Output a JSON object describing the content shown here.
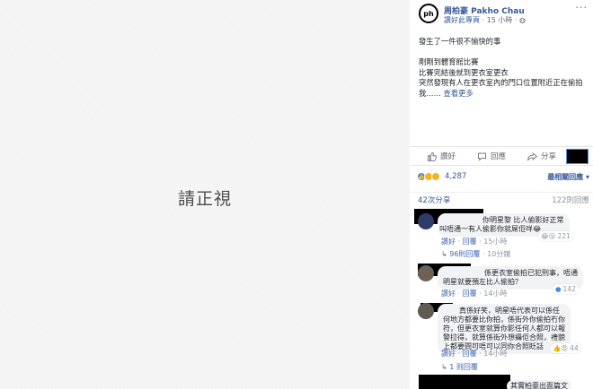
{
  "photo": {
    "overlay_text": "請正視"
  },
  "post": {
    "page_logo": "ph",
    "page_name": "周柏豪 Pakho Chau",
    "meta_link": "讚好此專頁",
    "meta_time": " · 15 小時 · ",
    "more": "···",
    "lines": [
      "發生了一件很不愉快的事",
      "",
      "剛剛到體育館比賽",
      "比賽完結後就到更衣室更衣",
      "突然發現有人在更衣室內的門口位置附近正在偷拍"
    ],
    "last_line_prefix": "我…… ",
    "see_more": "查看更多"
  },
  "actions": {
    "like": "讚好",
    "comment": "回應",
    "share": "分享"
  },
  "stats": {
    "reaction_count": "4,287",
    "sort_label": "最相關回應 ▾",
    "shares": "42次分享",
    "comments": "122則回應"
  },
  "comments": [
    {
      "lines": [
        "你明星黎 比人偷影好正常",
        "叫唔通一有人偷影你就屌佢咩😂"
      ],
      "like": "讚好",
      "reply": "回覆",
      "time": "15小時",
      "reactions": "221",
      "replies_prefix": "↳ ",
      "replies_label": "96則回覆",
      "replies_time": " · 10分鐘"
    },
    {
      "lines": [
        "係更衣室偷拍已犯刑事，唔通",
        "明星就要預左比人偷拍？"
      ],
      "like": "讚好",
      "reply": "回覆",
      "time": "14小時",
      "reactions": "142"
    },
    {
      "lines": [
        "真係好笑，明星唔代表可以係任",
        "何地方都要比你拍，係街外你偷拍冇你",
        "符，但更衣室就算你影任何人都可以報",
        "警拉得，就算係街外想攝佢合照，禮貌",
        "上都要問可唔可以同你合照眨話"
      ],
      "like": "讚好",
      "reply": "回覆",
      "time": "14小時",
      "reactions": "44",
      "replies_prefix": "↳ ",
      "replies_label": "1 则回覆"
    },
    {
      "partial": "其實柏豪出面篇文"
    }
  ],
  "colors": {
    "link": "#365899",
    "muted": "#90949c",
    "bubble": "#f2f3f5"
  }
}
